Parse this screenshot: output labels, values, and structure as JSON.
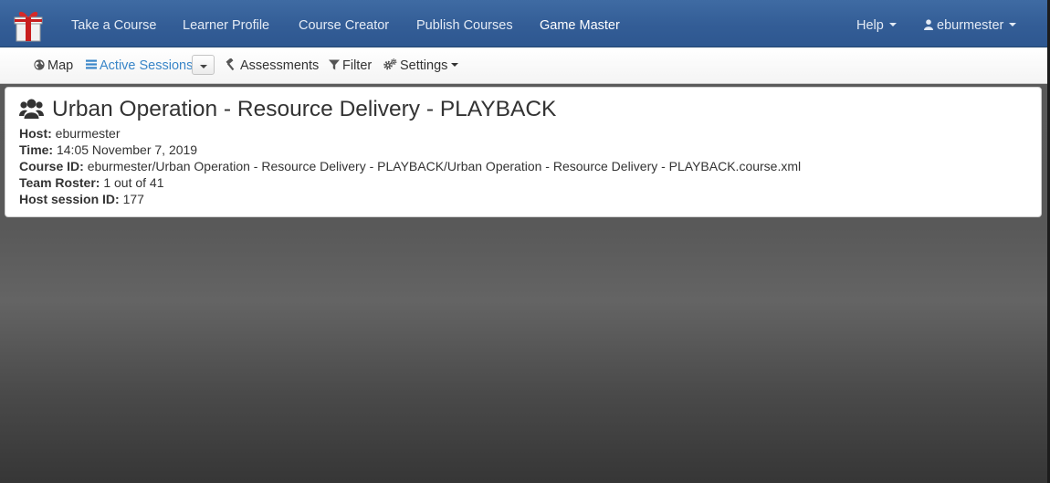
{
  "navbar": {
    "items": [
      {
        "label": "Take a Course"
      },
      {
        "label": "Learner Profile"
      },
      {
        "label": "Course Creator"
      },
      {
        "label": "Publish Courses"
      },
      {
        "label": "Game Master",
        "active": true
      }
    ],
    "help_label": "Help",
    "user_label": "eburmester"
  },
  "toolbar": {
    "map_label": "Map",
    "active_sessions_label": "Active Sessions",
    "assessments_label": "Assessments",
    "filter_label": "Filter",
    "settings_label": "Settings"
  },
  "session": {
    "title": "Urban Operation - Resource Delivery - PLAYBACK",
    "fields": [
      {
        "label": "Host:",
        "value": "eburmester"
      },
      {
        "label": "Time:",
        "value": "14:05 November 7, 2019"
      },
      {
        "label": "Course ID:",
        "value": "eburmester/Urban Operation - Resource Delivery - PLAYBACK/Urban Operation - Resource Delivery - PLAYBACK.course.xml"
      },
      {
        "label": "Team Roster:",
        "value": "1 out of 41"
      },
      {
        "label": "Host session ID:",
        "value": "177"
      }
    ]
  },
  "colors": {
    "navbar": "#335d96",
    "active_link": "#3a86c8"
  },
  "icons": {
    "logo": "gift-box-icon",
    "user": "user-icon",
    "map": "globe-icon",
    "active_sessions": "list-icon",
    "assessments": "gavel-icon",
    "filter": "filter-icon",
    "settings": "gears-icon",
    "session": "users-icon"
  }
}
